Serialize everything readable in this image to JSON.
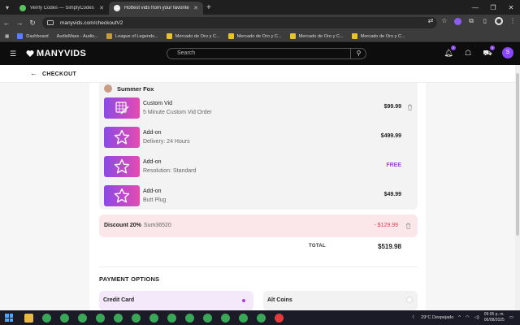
{
  "browser": {
    "tabs": [
      {
        "title": "Verify Codes — SimplyCodes",
        "active": false
      },
      {
        "title": "Hottest vids from your favorite",
        "active": true
      }
    ],
    "new_tab_label": "+",
    "url": "manyvids.com/checkoutV2",
    "bookmarks": [
      "Dashboard",
      "AudioMass - Audio...",
      "League of Legends...",
      "Mercado de Oro y C...",
      "Mercado de Oro y C...",
      "Mercado de Oro y C...",
      "Mercado de Oro y C..."
    ],
    "extension_badge": "2"
  },
  "site": {
    "logo": "MANYVIDS",
    "search_placeholder": "Search",
    "badges": {
      "notifications": "2",
      "cart": "5"
    },
    "avatar_letter": "S"
  },
  "checkout": {
    "title": "CHECKOUT",
    "seller": "Summer Fox",
    "items": [
      {
        "title": "Custom Vid",
        "subtitle": "5 Minute Custom Vid Order",
        "price": "$99.99",
        "free": false
      },
      {
        "title": "Add-on",
        "subtitle": "Delivery: 24 Hours",
        "price": "$499.99",
        "free": false
      },
      {
        "title": "Add-on",
        "subtitle": "Resolution: Standard",
        "price": "FREE",
        "free": true
      },
      {
        "title": "Add-on",
        "subtitle": "Butt Plug",
        "price": "$49.99",
        "free": false
      }
    ],
    "discount": {
      "label": "Discount 20%",
      "code": "Sum36520",
      "value": "- $129.99"
    },
    "total_label": "TOTAL",
    "total_value": "$519.98"
  },
  "payment": {
    "title": "PAYMENT OPTIONS",
    "options": [
      {
        "label": "Credit Card",
        "selected": true
      },
      {
        "label": "Alt Coins",
        "selected": false
      }
    ]
  },
  "taskbar": {
    "weather": "29°C  Despejado",
    "time": "09:05 p. m.",
    "date": "06/08/2025"
  },
  "colors": {
    "accent": "#b140d9",
    "discount_bg": "#fbe6ea",
    "discount_text": "#e04050"
  }
}
